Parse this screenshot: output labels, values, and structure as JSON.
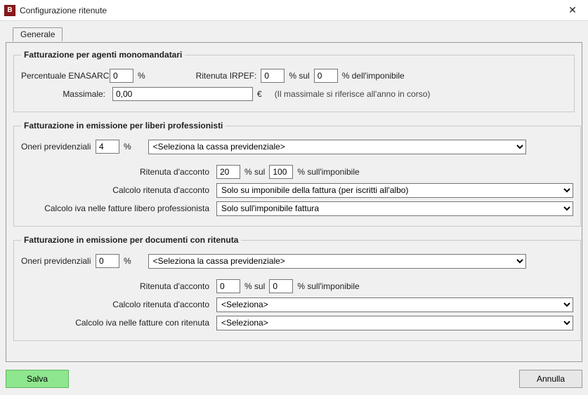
{
  "window": {
    "title": "Configurazione ritenute",
    "icon_text": "B",
    "close_glyph": "✕"
  },
  "tabs": {
    "generale": "Generale"
  },
  "group1": {
    "legend": "Fatturazione per agenti monomandatari",
    "enasarco_label": "Percentuale ENASARCO:",
    "enasarco_value": "0",
    "percent": "%",
    "irpef_label": "Ritenuta IRPEF:",
    "irpef_value": "0",
    "percent_sul": "% sul",
    "irpef_base": "0",
    "percent_imponibile": "% dell'imponibile",
    "massimale_label": "Massimale:",
    "massimale_value": "0,00",
    "euro": "€",
    "massimale_note": "(Il massimale si riferisce all'anno in corso)"
  },
  "group2": {
    "legend": "Fatturazione in emissione per liberi professionisti",
    "oneri_label": "Oneri previdenziali",
    "oneri_value": "4",
    "percent": "%",
    "cassa_placeholder": "<Seleziona la cassa previdenziale>",
    "rit_acconto_label": "Ritenuta d'acconto",
    "rit_acconto_value": "20",
    "percent_sul": "% sul",
    "rit_acconto_base": "100",
    "percent_sull_imponibile": "% sull'imponibile",
    "calcolo_rit_label": "Calcolo ritenuta d'acconto",
    "calcolo_rit_value": "Solo su imponibile della fattura (per iscritti all'albo)",
    "calcolo_iva_label": "Calcolo iva nelle fatture libero professionista",
    "calcolo_iva_value": "Solo sull'imponibile fattura"
  },
  "group3": {
    "legend": "Fatturazione in emissione per documenti con ritenuta",
    "oneri_label": "Oneri previdenziali",
    "oneri_value": "0",
    "percent": "%",
    "cassa_placeholder": "<Seleziona la cassa previdenziale>",
    "rit_acconto_label": "Ritenuta d'acconto",
    "rit_acconto_value": "0",
    "percent_sul": "% sul",
    "rit_acconto_base": "0",
    "percent_sull_imponibile": "% sull'imponibile",
    "calcolo_rit_label": "Calcolo ritenuta d'acconto",
    "calcolo_rit_value": "<Seleziona>",
    "calcolo_iva_label": "Calcolo iva nelle fatture con ritenuta",
    "calcolo_iva_value": "<Seleziona>"
  },
  "footer": {
    "save": "Salva",
    "cancel": "Annulla"
  }
}
